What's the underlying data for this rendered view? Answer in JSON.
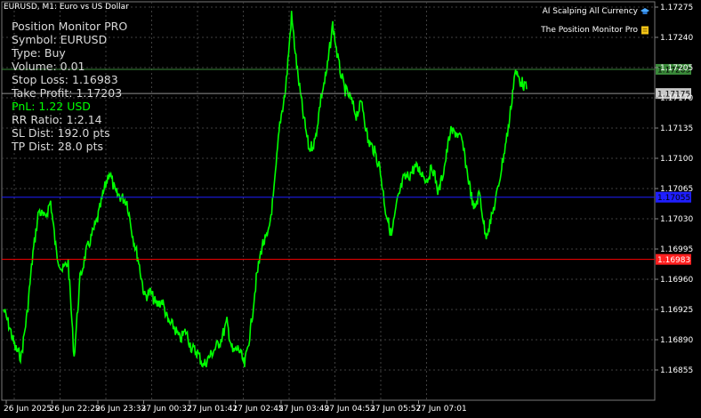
{
  "header": {
    "title": "EURUSD, M1:  Euro vs US Dollar"
  },
  "panel": {
    "title": "Position Monitor PRO",
    "symbol": "Symbol: EURUSD",
    "type": "Type: Buy",
    "volume": "Volume: 0.01",
    "stop_loss": "Stop Loss: 1.16983",
    "take_profit": "Take Profit: 1.17203",
    "pnl": "PnL: 1.22 USD",
    "rr": "RR Ratio: 1:2.14",
    "sl_dist": "SL Dist: 192.0 pts",
    "tp_dist": "TP Dist: 28.0 pts"
  },
  "indicators": [
    {
      "label": "AI Scalping All Currency",
      "icon": "graduation-cap-icon"
    },
    {
      "label": "The Position Monitor Pro",
      "icon": "note-icon"
    }
  ],
  "colors": {
    "background": "#000000",
    "candles": "#00ff00",
    "grid": "#404040",
    "tp_line": "#3a8a3a",
    "entry_line": "#909090",
    "sl_line": "#ff0000",
    "blue_line": "#1f1fff"
  },
  "chart_data": {
    "type": "line",
    "title": "EURUSD, M1:  Euro vs US Dollar",
    "y_ticks": [
      "1.17275",
      "1.17240",
      "1.17205",
      "1.17170",
      "1.17135",
      "1.17100",
      "1.17065",
      "1.17030",
      "1.16995",
      "1.16960",
      "1.16925",
      "1.16890",
      "1.16855"
    ],
    "x_ticks": [
      "26 Jun 2025",
      "26 Jun 22:29",
      "26 Jun 23:33",
      "27 Jun 00:37",
      "27 Jun 01:41",
      "27 Jun 02:45",
      "27 Jun 03:49",
      "27 Jun 04:53",
      "27 Jun 05:57",
      "27 Jun 07:01"
    ],
    "ylim": [
      1.16835,
      1.17285
    ],
    "price_lines": [
      {
        "name": "take-profit",
        "value": 1.17203,
        "label": "1.17203"
      },
      {
        "name": "current-price",
        "value": 1.17175,
        "label": "1.17175"
      },
      {
        "name": "blue-level",
        "value": 1.17055,
        "label": "1.17055"
      },
      {
        "name": "stop-loss",
        "value": 1.16983,
        "label": "1.16983"
      }
    ],
    "series": [
      {
        "values": [
          1.16925,
          1.16905,
          1.1688,
          1.1687,
          1.1692,
          1.1699,
          1.1704,
          1.1703,
          1.1705,
          1.1699,
          1.1697,
          1.1698,
          1.1687,
          1.1696,
          1.1699,
          1.1701,
          1.1703,
          1.1706,
          1.17085,
          1.1706,
          1.17055,
          1.1705,
          1.1701,
          1.1698,
          1.1694,
          1.16945,
          1.1693,
          1.16935,
          1.1691,
          1.16905,
          1.1689,
          1.169,
          1.1688,
          1.16875,
          1.1686,
          1.1687,
          1.1688,
          1.1689,
          1.1691,
          1.16875,
          1.1688,
          1.1686,
          1.169,
          1.1696,
          1.17,
          1.1701,
          1.1706,
          1.1714,
          1.1718,
          1.17265,
          1.172,
          1.1715,
          1.1711,
          1.1712,
          1.1717,
          1.172,
          1.17255,
          1.1721,
          1.1718,
          1.1717,
          1.1715,
          1.17165,
          1.1712,
          1.1711,
          1.1709,
          1.1704,
          1.1701,
          1.1705,
          1.17075,
          1.1708,
          1.1709,
          1.17085,
          1.17075,
          1.1709,
          1.1706,
          1.1709,
          1.1713,
          1.1713,
          1.1712,
          1.1708,
          1.1704,
          1.1706,
          1.1701,
          1.1703,
          1.1706,
          1.171,
          1.1714,
          1.172,
          1.1719,
          1.1718
        ]
      }
    ]
  }
}
